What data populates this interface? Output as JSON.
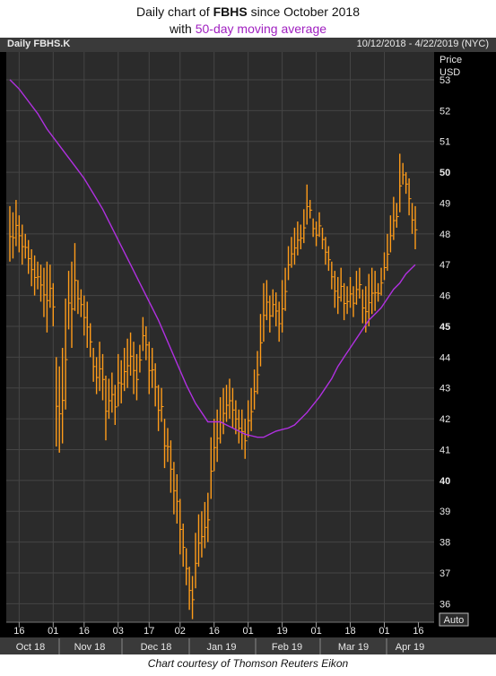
{
  "title": {
    "prefix": "Daily chart of",
    "ticker": "FBHS",
    "suffix": "since October 2018",
    "line2_prefix": "with",
    "line2_highlight": "50-day moving average"
  },
  "header": {
    "symbol": "Daily FBHS.K",
    "range": "10/12/2018 - 4/22/2019 (NYC)"
  },
  "footer": "Chart courtesy of Thomson Reuters Eikon",
  "colors": {
    "price": "#ff9c1a",
    "ma": "#b030e0",
    "background": "#2b2b2b",
    "grid": "#454545"
  },
  "chart_data": {
    "type": "line",
    "ylabel": "Price",
    "yunit": "USD",
    "ylim": [
      35.4,
      53.9
    ],
    "yticks": [
      36,
      37,
      38,
      39,
      40,
      41,
      42,
      43,
      44,
      45,
      46,
      47,
      48,
      49,
      50,
      51,
      52,
      53
    ],
    "scale_mode": "Auto",
    "x_day_labels": [
      "16",
      "01",
      "16",
      "03",
      "17",
      "02",
      "16",
      "01",
      "19",
      "01",
      "18",
      "01",
      "16"
    ],
    "x_month_labels": [
      "Oct 18",
      "Nov 18",
      "Dec 18",
      "Jan 19",
      "Feb 19",
      "Mar 19",
      "Apr 19"
    ],
    "series": [
      {
        "name": "FBHS.K",
        "style": "ohlc-bars",
        "bars": [
          [
            0,
            47.1,
            48.9
          ],
          [
            1,
            47.2,
            48.7
          ],
          [
            2,
            47.6,
            49.1
          ],
          [
            3,
            47.4,
            48.6
          ],
          [
            4,
            47.0,
            48.3
          ],
          [
            5,
            47.2,
            48.0
          ],
          [
            6,
            46.7,
            47.8
          ],
          [
            7,
            46.3,
            47.5
          ],
          [
            8,
            46.0,
            47.3
          ],
          [
            9,
            46.2,
            47.1
          ],
          [
            10,
            45.8,
            47.0
          ],
          [
            11,
            45.3,
            46.9
          ],
          [
            12,
            44.8,
            47.1
          ],
          [
            13,
            45.6,
            47.0
          ],
          [
            14,
            45.0,
            46.4
          ],
          [
            15,
            41.1,
            44.0
          ],
          [
            16,
            40.9,
            43.7
          ],
          [
            17,
            41.2,
            44.3
          ],
          [
            18,
            42.3,
            45.9
          ],
          [
            19,
            44.9,
            46.8
          ],
          [
            20,
            44.3,
            47.1
          ],
          [
            21,
            45.5,
            47.7
          ],
          [
            22,
            45.4,
            46.5
          ],
          [
            23,
            45.3,
            46.2
          ],
          [
            24,
            44.7,
            46.0
          ],
          [
            25,
            44.3,
            45.8
          ],
          [
            26,
            44.0,
            45.1
          ],
          [
            27,
            43.2,
            44.3
          ],
          [
            28,
            42.8,
            44.0
          ],
          [
            29,
            42.9,
            44.5
          ],
          [
            30,
            42.6,
            44.1
          ],
          [
            31,
            41.3,
            43.4
          ],
          [
            32,
            42.0,
            43.3
          ],
          [
            33,
            42.2,
            43.5
          ],
          [
            34,
            41.8,
            43.1
          ],
          [
            35,
            42.4,
            44.1
          ],
          [
            36,
            42.5,
            43.9
          ],
          [
            37,
            42.9,
            44.3
          ],
          [
            38,
            43.0,
            44.6
          ],
          [
            39,
            43.4,
            44.8
          ],
          [
            40,
            42.8,
            44.5
          ],
          [
            41,
            42.6,
            44.1
          ],
          [
            42,
            43.5,
            44.4
          ],
          [
            43,
            44.2,
            45.3
          ],
          [
            44,
            43.9,
            45.0
          ],
          [
            45,
            42.8,
            44.5
          ],
          [
            46,
            43.0,
            44.3
          ],
          [
            47,
            42.4,
            43.8
          ],
          [
            48,
            41.6,
            43.1
          ],
          [
            49,
            41.9,
            43.0
          ],
          [
            50,
            40.4,
            42.0
          ],
          [
            51,
            40.6,
            41.7
          ],
          [
            52,
            39.6,
            41.3
          ],
          [
            53,
            38.9,
            40.6
          ],
          [
            54,
            38.6,
            40.2
          ],
          [
            55,
            37.6,
            39.4
          ],
          [
            56,
            37.2,
            38.6
          ],
          [
            57,
            36.6,
            37.8
          ],
          [
            58,
            35.8,
            37.2
          ],
          [
            59,
            35.5,
            36.9
          ],
          [
            60,
            36.5,
            38.3
          ],
          [
            61,
            37.2,
            38.9
          ],
          [
            62,
            37.5,
            39.0
          ],
          [
            63,
            37.8,
            39.3
          ],
          [
            64,
            38.0,
            39.6
          ],
          [
            65,
            39.4,
            41.4
          ],
          [
            66,
            40.3,
            42.0
          ],
          [
            67,
            40.6,
            42.3
          ],
          [
            68,
            41.2,
            42.7
          ],
          [
            69,
            41.5,
            43.0
          ],
          [
            70,
            41.9,
            43.1
          ],
          [
            71,
            42.0,
            43.3
          ],
          [
            72,
            41.7,
            43.0
          ],
          [
            73,
            41.5,
            42.6
          ],
          [
            74,
            41.2,
            42.3
          ],
          [
            75,
            41.0,
            42.3
          ],
          [
            76,
            40.7,
            42.0
          ],
          [
            77,
            41.4,
            42.6
          ],
          [
            78,
            41.6,
            43.0
          ],
          [
            79,
            42.3,
            43.6
          ],
          [
            80,
            42.8,
            44.2
          ],
          [
            81,
            43.7,
            45.4
          ],
          [
            82,
            44.5,
            46.4
          ],
          [
            83,
            45.2,
            46.5
          ],
          [
            84,
            44.8,
            46.0
          ],
          [
            85,
            45.3,
            46.2
          ],
          [
            86,
            45.0,
            46.1
          ],
          [
            87,
            44.5,
            45.8
          ],
          [
            88,
            44.8,
            46.5
          ],
          [
            89,
            45.5,
            46.9
          ],
          [
            90,
            46.5,
            47.6
          ],
          [
            91,
            46.9,
            47.9
          ],
          [
            92,
            47.0,
            48.2
          ],
          [
            93,
            47.3,
            48.4
          ],
          [
            94,
            47.5,
            48.3
          ],
          [
            95,
            47.7,
            48.8
          ],
          [
            96,
            48.3,
            49.6
          ],
          [
            97,
            48.5,
            49.1
          ],
          [
            98,
            47.9,
            48.5
          ],
          [
            99,
            47.6,
            48.4
          ],
          [
            100,
            47.9,
            48.7
          ],
          [
            101,
            47.5,
            48.2
          ],
          [
            102,
            47.0,
            47.9
          ],
          [
            103,
            46.8,
            47.6
          ],
          [
            104,
            46.2,
            47.1
          ],
          [
            105,
            45.6,
            46.8
          ],
          [
            106,
            45.4,
            46.6
          ],
          [
            107,
            45.8,
            46.9
          ],
          [
            108,
            45.2,
            46.4
          ],
          [
            109,
            45.4,
            46.3
          ],
          [
            110,
            45.6,
            46.6
          ],
          [
            111,
            45.3,
            46.3
          ],
          [
            112,
            45.7,
            46.8
          ],
          [
            113,
            45.9,
            46.9
          ],
          [
            114,
            45.1,
            46.2
          ],
          [
            115,
            44.8,
            46.3
          ],
          [
            116,
            45.0,
            46.7
          ],
          [
            117,
            45.4,
            46.9
          ],
          [
            118,
            45.5,
            46.8
          ],
          [
            119,
            45.8,
            46.4
          ],
          [
            120,
            46.0,
            46.9
          ],
          [
            121,
            46.5,
            47.4
          ],
          [
            122,
            46.8,
            48.0
          ],
          [
            123,
            47.4,
            48.6
          ],
          [
            124,
            47.8,
            49.2
          ],
          [
            125,
            48.2,
            49.0
          ],
          [
            126,
            48.7,
            50.6
          ],
          [
            127,
            49.6,
            50.3
          ],
          [
            128,
            49.3,
            50.0
          ],
          [
            129,
            48.6,
            49.8
          ],
          [
            130,
            48.0,
            49.0
          ],
          [
            131,
            47.5,
            48.9
          ]
        ]
      },
      {
        "name": "50-day MA",
        "style": "line",
        "points": [
          [
            0,
            53.0
          ],
          [
            3,
            52.7
          ],
          [
            6,
            52.3
          ],
          [
            9,
            51.9
          ],
          [
            12,
            51.4
          ],
          [
            15,
            51.0
          ],
          [
            18,
            50.6
          ],
          [
            21,
            50.2
          ],
          [
            24,
            49.8
          ],
          [
            27,
            49.3
          ],
          [
            30,
            48.8
          ],
          [
            33,
            48.2
          ],
          [
            36,
            47.6
          ],
          [
            39,
            47.0
          ],
          [
            42,
            46.4
          ],
          [
            45,
            45.8
          ],
          [
            48,
            45.2
          ],
          [
            51,
            44.5
          ],
          [
            54,
            43.8
          ],
          [
            57,
            43.1
          ],
          [
            60,
            42.5
          ],
          [
            62,
            42.2
          ],
          [
            64,
            41.9
          ],
          [
            66,
            41.9
          ],
          [
            68,
            41.9
          ],
          [
            70,
            41.8
          ],
          [
            72,
            41.7
          ],
          [
            74,
            41.6
          ],
          [
            76,
            41.5
          ],
          [
            78,
            41.45
          ],
          [
            80,
            41.4
          ],
          [
            82,
            41.4
          ],
          [
            84,
            41.5
          ],
          [
            86,
            41.6
          ],
          [
            88,
            41.65
          ],
          [
            90,
            41.7
          ],
          [
            92,
            41.8
          ],
          [
            94,
            42.0
          ],
          [
            96,
            42.2
          ],
          [
            98,
            42.45
          ],
          [
            100,
            42.7
          ],
          [
            102,
            43.0
          ],
          [
            104,
            43.3
          ],
          [
            106,
            43.7
          ],
          [
            108,
            44.0
          ],
          [
            110,
            44.3
          ],
          [
            112,
            44.6
          ],
          [
            114,
            44.9
          ],
          [
            116,
            45.2
          ],
          [
            118,
            45.4
          ],
          [
            120,
            45.6
          ],
          [
            122,
            45.9
          ],
          [
            124,
            46.2
          ],
          [
            126,
            46.4
          ],
          [
            128,
            46.7
          ],
          [
            130,
            46.9
          ],
          [
            131,
            47.0
          ]
        ]
      }
    ]
  }
}
